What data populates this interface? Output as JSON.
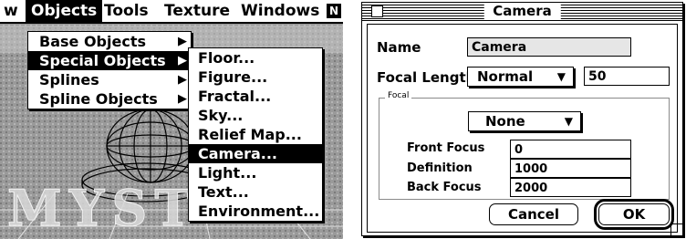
{
  "menubar": {
    "items": [
      {
        "label": "w"
      },
      {
        "label": "Objects"
      },
      {
        "label": "Tools"
      },
      {
        "label": "Texture"
      },
      {
        "label": "Windows"
      }
    ],
    "app_icon": "N"
  },
  "objects_menu": {
    "items": [
      {
        "label": "Base Objects",
        "submenu": true
      },
      {
        "label": "Special Objects",
        "submenu": true
      },
      {
        "label": "Splines",
        "submenu": true
      },
      {
        "label": "Spline Objects",
        "submenu": true
      }
    ]
  },
  "special_objects_menu": {
    "items": [
      "Floor...",
      "Figure...",
      "Fractal...",
      "Sky...",
      "Relief Map...",
      "Camera...",
      "Light...",
      "Text...",
      "Environment..."
    ],
    "highlighted": "Camera..."
  },
  "background_text": "MYST",
  "dialog": {
    "title": "Camera",
    "name_label": "Name",
    "name_value": "Camera",
    "focal_length_label": "Focal Length",
    "focal_length_option": "Normal",
    "focal_length_value": "50",
    "focal_group_title": "Focal",
    "focal_option": "None",
    "front_focus_label": "Front Focus",
    "front_focus_value": "0",
    "definition_label": "Definition",
    "definition_value": "1000",
    "back_focus_label": "Back Focus",
    "back_focus_value": "2000",
    "cancel_label": "Cancel",
    "ok_label": "OK"
  },
  "icons": {
    "submenu_arrow": "triangle-right",
    "popup_arrow": "triangle-down"
  }
}
